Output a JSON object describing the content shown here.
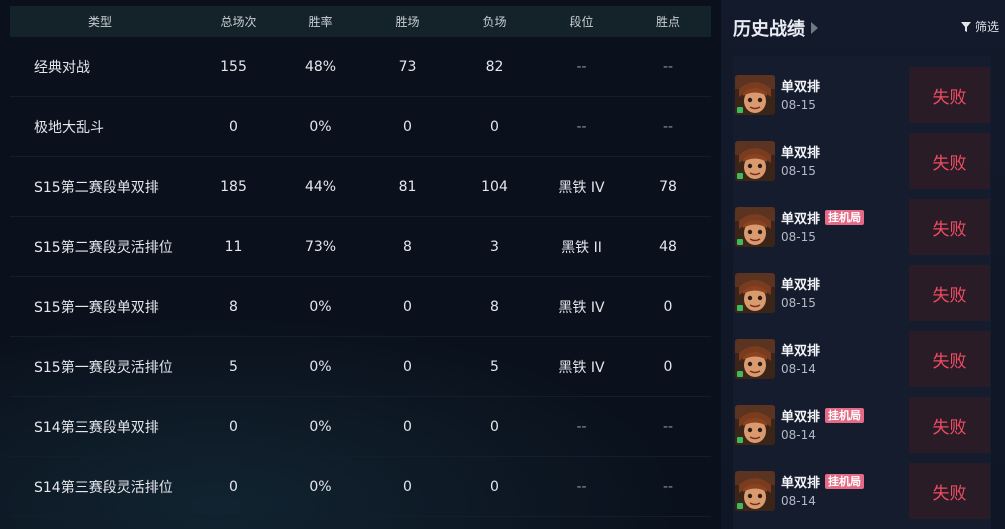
{
  "table": {
    "headers": [
      "类型",
      "总场次",
      "胜率",
      "胜场",
      "负场",
      "段位",
      "胜点"
    ],
    "rows": [
      [
        "经典对战",
        "155",
        "48%",
        "73",
        "82",
        "--",
        "--"
      ],
      [
        "极地大乱斗",
        "0",
        "0%",
        "0",
        "0",
        "--",
        "--"
      ],
      [
        "S15第二赛段单双排",
        "185",
        "44%",
        "81",
        "104",
        "黑铁 IV",
        "78"
      ],
      [
        "S15第二赛段灵活排位",
        "11",
        "73%",
        "8",
        "3",
        "黑铁 II",
        "48"
      ],
      [
        "S15第一赛段单双排",
        "8",
        "0%",
        "0",
        "8",
        "黑铁 IV",
        "0"
      ],
      [
        "S15第一赛段灵活排位",
        "5",
        "0%",
        "0",
        "5",
        "黑铁 IV",
        "0"
      ],
      [
        "S14第三赛段单双排",
        "0",
        "0%",
        "0",
        "0",
        "--",
        "--"
      ],
      [
        "S14第三赛段灵活排位",
        "0",
        "0%",
        "0",
        "0",
        "--",
        "--"
      ]
    ]
  },
  "history": {
    "title": "历史战绩",
    "filter_label": "筛选",
    "matches": [
      {
        "mode": "单双排",
        "date": "08-15",
        "result": "失败",
        "afk": ""
      },
      {
        "mode": "单双排",
        "date": "08-15",
        "result": "失败",
        "afk": ""
      },
      {
        "mode": "单双排",
        "date": "08-15",
        "result": "失败",
        "afk": "挂机局"
      },
      {
        "mode": "单双排",
        "date": "08-15",
        "result": "失败",
        "afk": ""
      },
      {
        "mode": "单双排",
        "date": "08-14",
        "result": "失败",
        "afk": ""
      },
      {
        "mode": "单双排",
        "date": "08-14",
        "result": "失败",
        "afk": "挂机局"
      },
      {
        "mode": "单双排",
        "date": "08-14",
        "result": "失败",
        "afk": "挂机局"
      }
    ]
  },
  "colors": {
    "background": "#0a111c",
    "header_bg": "#142329",
    "defeat_text": "#ef4d62",
    "afk_badge": "#e46a86"
  }
}
